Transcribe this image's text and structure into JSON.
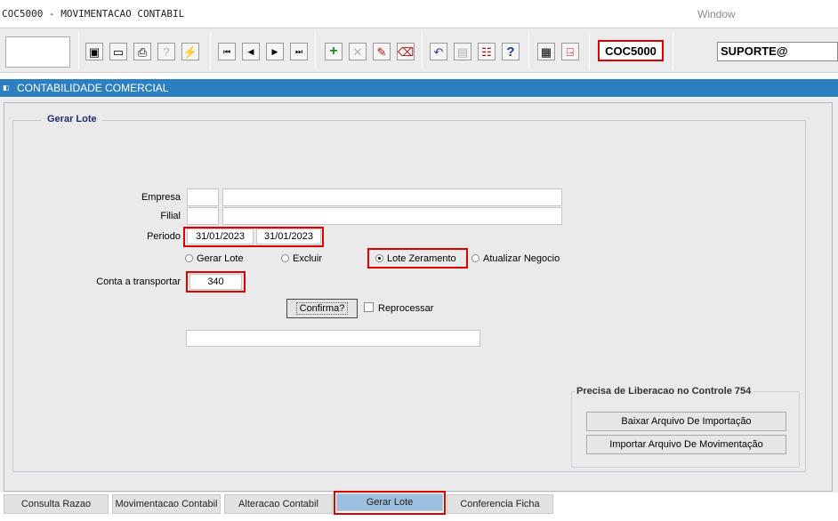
{
  "title_bar": {
    "app_title": "COC5000 - MOVIMENTACAO CONTABIL",
    "window_menu": "Window"
  },
  "toolbar": {
    "form_code": "COC5000",
    "user": "SUPORTE@",
    "buttons": [
      {
        "name": "save",
        "icon": "floppy-icon",
        "glyph": "▣"
      },
      {
        "name": "print-preview",
        "icon": "monitor-icon",
        "glyph": "▭"
      },
      {
        "name": "print",
        "icon": "printer-icon",
        "glyph": "⎙"
      },
      {
        "name": "query-help",
        "icon": "query-icon",
        "glyph": "?"
      },
      {
        "name": "query-run",
        "icon": "query-run-icon",
        "glyph": "⚡"
      },
      {
        "name": "first-record",
        "icon": "first-icon",
        "glyph": "⏮"
      },
      {
        "name": "prev-record",
        "icon": "prev-icon",
        "glyph": "◀"
      },
      {
        "name": "next-record",
        "icon": "next-icon",
        "glyph": "▶"
      },
      {
        "name": "last-record",
        "icon": "last-icon",
        "glyph": "⏭"
      },
      {
        "name": "insert",
        "icon": "plus-icon",
        "glyph": "+"
      },
      {
        "name": "delete",
        "icon": "x-icon",
        "glyph": "✕"
      },
      {
        "name": "edit",
        "icon": "edit-icon",
        "glyph": "✎"
      },
      {
        "name": "clear",
        "icon": "eraser-icon",
        "glyph": "⌫"
      },
      {
        "name": "undo",
        "icon": "undo-icon",
        "glyph": "↶"
      },
      {
        "name": "clipboard",
        "icon": "clipboard-icon",
        "glyph": "▤"
      },
      {
        "name": "lov",
        "icon": "list-icon",
        "glyph": "☷"
      },
      {
        "name": "help",
        "icon": "question-icon",
        "glyph": "?"
      },
      {
        "name": "menu",
        "icon": "menu-icon",
        "glyph": "▦"
      },
      {
        "name": "exit",
        "icon": "exit-door-icon",
        "glyph": "⍈"
      }
    ]
  },
  "module": {
    "title": "CONTABILIDADE COMERCIAL"
  },
  "form": {
    "group_title": "Gerar Lote",
    "empresa_label": "Empresa",
    "empresa_code": "",
    "empresa_name": "",
    "filial_label": "Filial",
    "filial_code": "",
    "filial_name": "",
    "periodo_label": "Periodo",
    "periodo_inicio": "31/01/2023",
    "periodo_fim": "31/01/2023",
    "options": [
      {
        "label": "Gerar Lote",
        "selected": false
      },
      {
        "label": "Excluir",
        "selected": false
      },
      {
        "label": "Lote Zeramento",
        "selected": true
      },
      {
        "label": "Atualizar Negocio",
        "selected": false
      }
    ],
    "conta_label": "Conta a transportar",
    "conta_value": "340",
    "confirm_label": "Confirma?",
    "reprocessar_label": "Reprocessar",
    "reprocessar_checked": false,
    "message_value": ""
  },
  "liberacao": {
    "title": "Precisa de Liberacao no Controle 754",
    "baixar_label": "Baixar Arquivo De Importação",
    "importar_label": "Importar Arquivo De Movimentação"
  },
  "tabs": [
    {
      "label": "Consulta Razao",
      "active": false
    },
    {
      "label": "Movimentacao Contabil",
      "active": false
    },
    {
      "label": "Alteracao Contabil",
      "active": false
    },
    {
      "label": "Gerar Lote",
      "active": true
    },
    {
      "label": "Conferencia Ficha",
      "active": false
    }
  ],
  "colors": {
    "header_blue": "#2c7fc0",
    "highlight_red": "#e00000",
    "active_tab": "#9cbfe0"
  }
}
